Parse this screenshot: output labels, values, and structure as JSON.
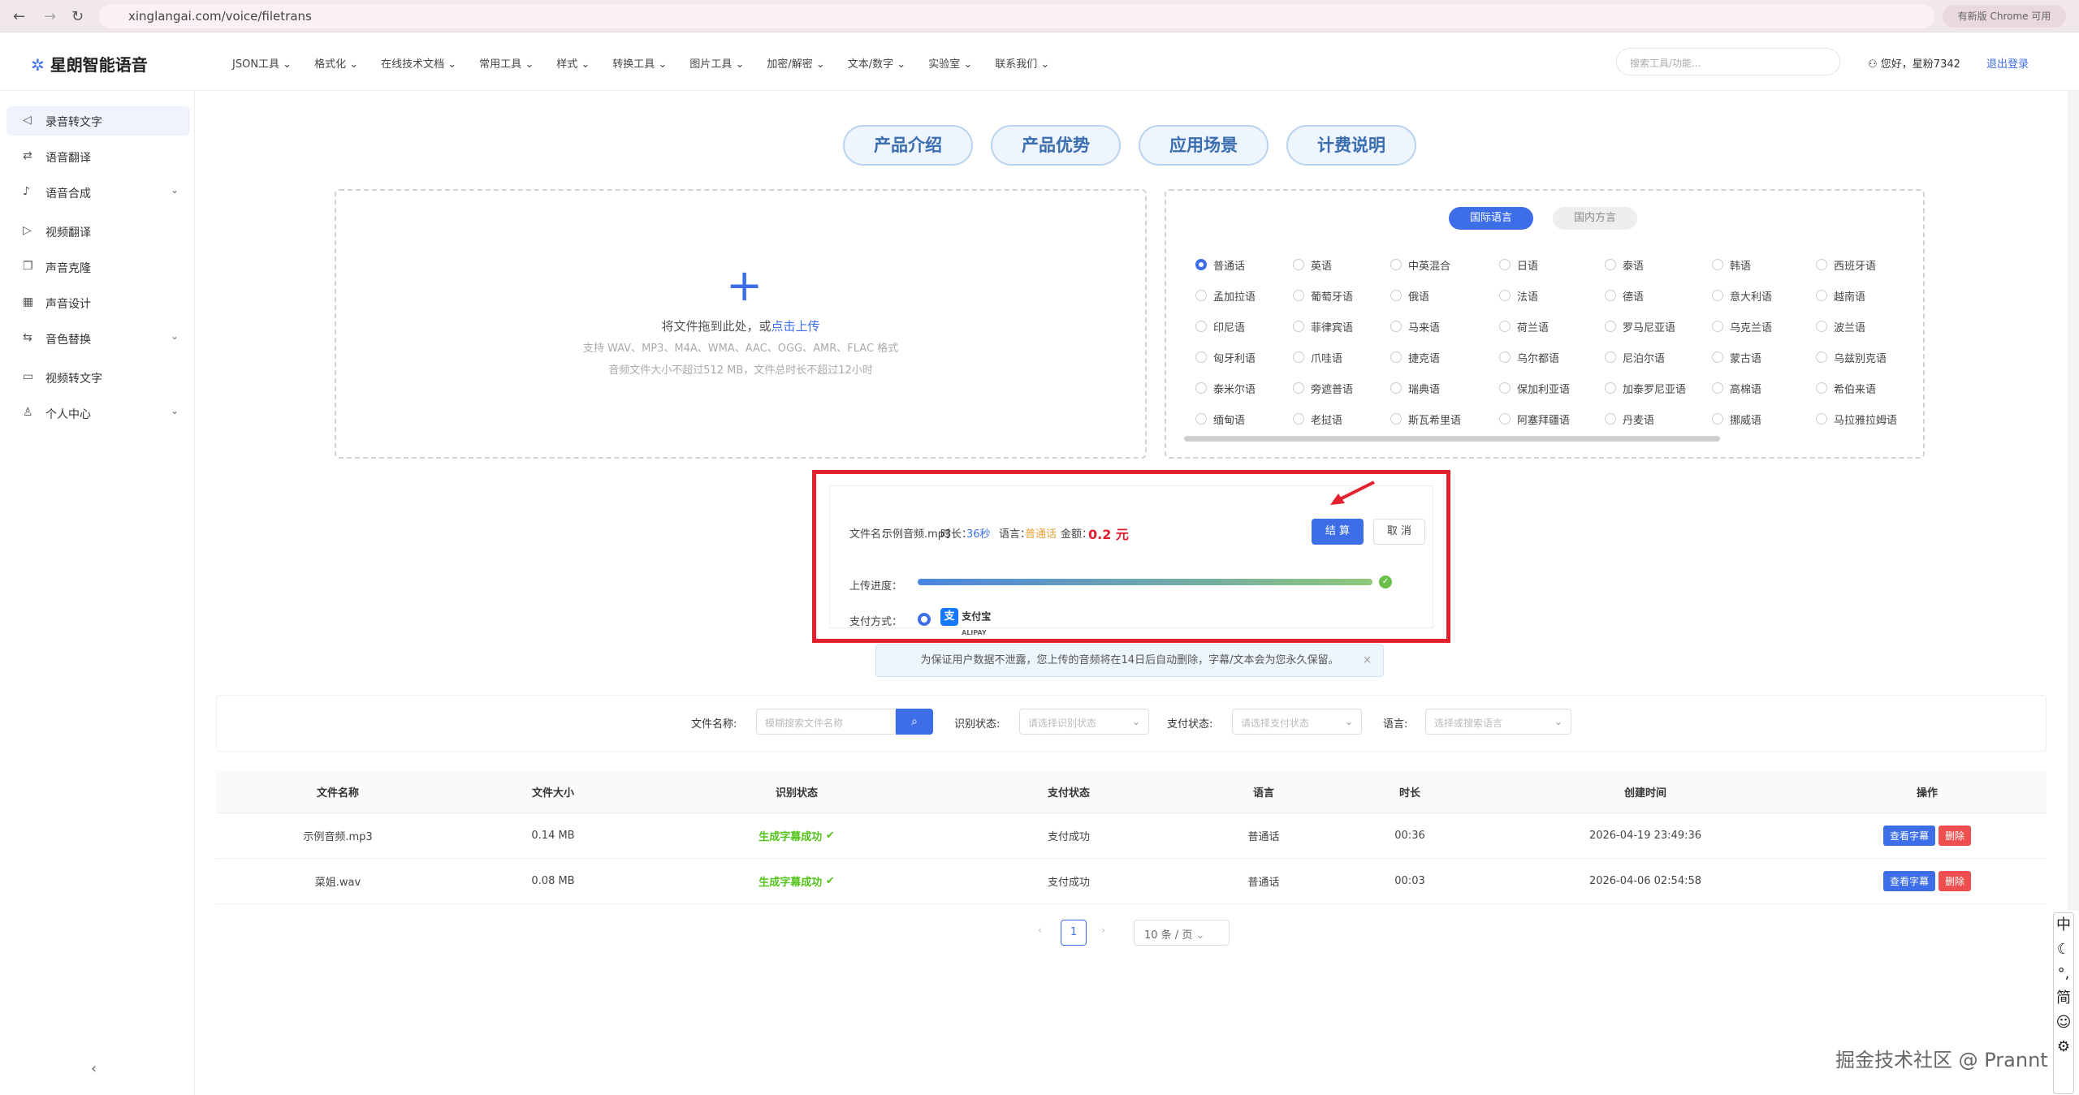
{
  "browser": {
    "url": "xinglangai.com/voice/filetrans",
    "new_chrome": "有新版 Chrome 可用"
  },
  "header": {
    "logo": "星朗智能语音",
    "menu": [
      "JSON工具",
      "格式化",
      "在线技术文档",
      "常用工具",
      "样式",
      "转换工具",
      "图片工具",
      "加密/解密",
      "文本/数字",
      "实验室",
      "联系我们"
    ],
    "search_placeholder": "搜索工具/功能...",
    "greeting": "您好，星粉7342",
    "logout": "退出登录"
  },
  "sidebar": {
    "items": [
      {
        "label": "录音转文字",
        "icon": "speaker-icon",
        "active": true
      },
      {
        "label": "语音翻译",
        "icon": "translate-icon"
      },
      {
        "label": "语音合成",
        "icon": "mic-icon",
        "chev": true
      },
      {
        "label": "视频翻译",
        "icon": "play-icon"
      },
      {
        "label": "声音克隆",
        "icon": "copy-icon"
      },
      {
        "label": "声音设计",
        "icon": "grid-icon"
      },
      {
        "label": "音色替换",
        "icon": "swap-icon",
        "chev": true
      },
      {
        "label": "视频转文字",
        "icon": "video-icon"
      },
      {
        "label": "个人中心",
        "icon": "user-icon",
        "chev": true
      }
    ]
  },
  "tabs": [
    "产品介绍",
    "产品优势",
    "应用场景",
    "计费说明"
  ],
  "upload": {
    "text": "将文件拖到此处，或",
    "link": "点击上传",
    "formats": "支持 WAV、MP3、M4A、WMA、AAC、OGG、AMR、FLAC 格式",
    "limits": "音频文件大小不超过512 MB，文件总时长不超过12小时"
  },
  "language": {
    "tab_intl": "国际语言",
    "tab_domestic": "国内方言",
    "options": [
      "普通话",
      "英语",
      "中英混合",
      "日语",
      "泰语",
      "韩语",
      "西班牙语",
      "孟加拉语",
      "葡萄牙语",
      "俄语",
      "法语",
      "德语",
      "意大利语",
      "越南语",
      "印尼语",
      "菲律宾语",
      "马来语",
      "荷兰语",
      "罗马尼亚语",
      "乌克兰语",
      "波兰语",
      "匈牙利语",
      "爪哇语",
      "捷克语",
      "乌尔都语",
      "尼泊尔语",
      "蒙古语",
      "乌兹别克语",
      "泰米尔语",
      "旁遮普语",
      "瑞典语",
      "保加利亚语",
      "加泰罗尼亚语",
      "高棉语",
      "希伯来语",
      "缅甸语",
      "老挝语",
      "斯瓦希里语",
      "阿塞拜疆语",
      "丹麦语",
      "挪威语",
      "马拉雅拉姆语"
    ],
    "selected": "普通话"
  },
  "order": {
    "filename_label": "文件名：",
    "filename": "示例音频.mp3",
    "duration_label": "时长：",
    "duration": "36秒",
    "language_label": "语言：",
    "language": "普通话",
    "amount_label": "金额：",
    "amount": "0.2 元",
    "settle": "结 算",
    "cancel": "取 消",
    "progress_label": "上传进度：",
    "progress": 1.0,
    "pay_label": "支付方式：",
    "pay_method": "支付宝",
    "pay_method_sub": "ALIPAY"
  },
  "notice": "为保证用户数据不泄露，您上传的音频将在14日后自动删除，字幕/文本会为您永久保留。",
  "filters": {
    "filename_label": "文件名称:",
    "filename_placeholder": "模糊搜索文件名称",
    "recog_label": "识别状态:",
    "recog_placeholder": "请选择识别状态",
    "pay_label": "支付状态:",
    "pay_placeholder": "请选择支付状态",
    "lang_label": "语言:",
    "lang_placeholder": "选择或搜索语言"
  },
  "table": {
    "headers": [
      "文件名称",
      "文件大小",
      "识别状态",
      "支付状态",
      "语言",
      "时长",
      "创建时间",
      "操作"
    ],
    "rows": [
      [
        "示例音频.mp3",
        "0.14 MB",
        "生成字幕成功",
        "支付成功",
        "普通话",
        "00:36",
        "2026-04-19 23:49:36"
      ],
      [
        "菜姐.wav",
        "0.08 MB",
        "生成字幕成功",
        "支付成功",
        "普通话",
        "00:03",
        "2026-04-06 02:54:58"
      ]
    ],
    "view_btn": "查看字幕",
    "del_btn": "删除"
  },
  "pagination": {
    "page": "1",
    "size": "10 条 / 页"
  },
  "watermark": "掘金技术社区 @ Prannt",
  "ime": [
    "中",
    "简"
  ],
  "colors": {
    "accent": "#3d6ee8",
    "highlight_border": "#e3202e",
    "success": "#52c41a"
  }
}
